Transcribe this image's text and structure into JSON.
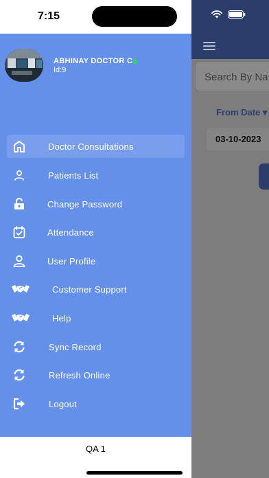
{
  "status_bar": {
    "time": "7:15"
  },
  "background": {
    "search_placeholder": "Search By Na",
    "from_date_label": "From Date ▾",
    "date_value": "03-10-2023"
  },
  "drawer": {
    "user_name": "ABHINAY DOCTOR C",
    "user_id": "Id:9",
    "items": [
      {
        "label": "Doctor Consultations",
        "icon": "home-icon"
      },
      {
        "label": "Patients List",
        "icon": "person-icon"
      },
      {
        "label": "Change Password",
        "icon": "unlock-icon"
      },
      {
        "label": "Attendance",
        "icon": "calendar-check-icon"
      },
      {
        "label": "User Profile",
        "icon": "user-icon"
      },
      {
        "label": "Customer Support",
        "icon": "handshake-icon"
      },
      {
        "label": "Help",
        "icon": "handshake-icon"
      },
      {
        "label": "Sync Record",
        "icon": "sync-icon"
      },
      {
        "label": "Refresh Online",
        "icon": "refresh-icon"
      },
      {
        "label": "Logout",
        "icon": "logout-icon"
      }
    ],
    "footer": "QA 1"
  },
  "colors": {
    "drawer_bg": "#6590ea",
    "header_bg": "#2b3e6b",
    "online": "#2fd46a"
  }
}
